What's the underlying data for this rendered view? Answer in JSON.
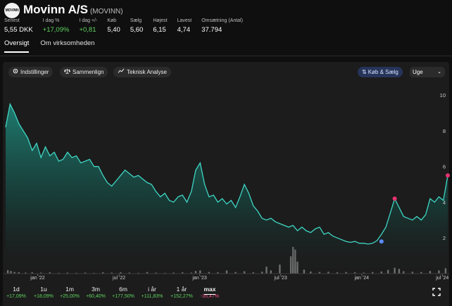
{
  "header": {
    "logo_text": "MOVINN",
    "title": "Movinn A/S",
    "ticker": "(MOVINN)"
  },
  "stats": [
    {
      "label": "Senest",
      "value": "5,55 DKK",
      "tone": "neutral"
    },
    {
      "label": "I dag %",
      "value": "+17,09%",
      "tone": "pos"
    },
    {
      "label": "I dag +/-",
      "value": "+0,81",
      "tone": "pos"
    },
    {
      "label": "Køb",
      "value": "5,40",
      "tone": "neutral"
    },
    {
      "label": "Sælg",
      "value": "5,60",
      "tone": "neutral"
    },
    {
      "label": "Højest",
      "value": "6,15",
      "tone": "neutral"
    },
    {
      "label": "Lavest",
      "value": "4,74",
      "tone": "neutral"
    },
    {
      "label": "Omsætning (Antal)",
      "value": "37.794",
      "tone": "neutral"
    }
  ],
  "tabs": [
    {
      "label": "Oversigt",
      "active": true
    },
    {
      "label": "Om virksomheden",
      "active": false
    }
  ],
  "toolbar": {
    "settings": "Indstillinger",
    "compare": "Sammenlign",
    "technical": "Teknisk Analyse",
    "trade": "Køb & Sælg",
    "period": "Uge"
  },
  "ranges": [
    {
      "label": "1d",
      "change": "+17,09%",
      "tone": "pos",
      "active": false
    },
    {
      "label": "1u",
      "change": "+18,09%",
      "tone": "pos",
      "active": false
    },
    {
      "label": "1m",
      "change": "+25,00%",
      "tone": "pos",
      "active": false
    },
    {
      "label": "3m",
      "change": "+60,40%",
      "tone": "pos",
      "active": false
    },
    {
      "label": "6m",
      "change": "+177,50%",
      "tone": "pos",
      "active": false
    },
    {
      "label": "i år",
      "change": "+111,83%",
      "tone": "pos",
      "active": false
    },
    {
      "label": "1 år",
      "change": "+152,27%",
      "tone": "pos",
      "active": false
    },
    {
      "label": "max",
      "change": "-35,47%",
      "tone": "neg",
      "active": true
    }
  ],
  "colors": {
    "line": "#3fd6c4",
    "positive": "#5fd35f",
    "negative": "#ff4f8b",
    "high_marker": "#e8336f",
    "low_marker": "#5b8dff"
  },
  "chart_data": {
    "type": "area",
    "x_axis_ticks": [
      "jan '22",
      "jul '22",
      "jan '23",
      "jul '23",
      "jan '24",
      "jul '24"
    ],
    "y_axis_ticks": [
      2,
      4,
      6,
      8,
      10
    ],
    "ylim": [
      1.1,
      10.6
    ],
    "xlim": [
      0,
      100
    ],
    "tick_positions": [
      9.5,
      33.6,
      57.5,
      81.5,
      105.5,
      129.4
    ],
    "grid": false,
    "price": [
      [
        0.0,
        8.2
      ],
      [
        1.0,
        9.5
      ],
      [
        2.0,
        9.0
      ],
      [
        3.0,
        8.4
      ],
      [
        4.0,
        8.0
      ],
      [
        5.0,
        7.6
      ],
      [
        6.0,
        6.9
      ],
      [
        7.0,
        7.3
      ],
      [
        8.0,
        6.5
      ],
      [
        9.0,
        7.1
      ],
      [
        10.0,
        6.6
      ],
      [
        11.0,
        6.8
      ],
      [
        12.0,
        6.3
      ],
      [
        13.0,
        6.4
      ],
      [
        14.0,
        6.8
      ],
      [
        15.0,
        6.5
      ],
      [
        16.0,
        6.6
      ],
      [
        17.0,
        6.2
      ],
      [
        18.0,
        6.3
      ],
      [
        19.0,
        6.4
      ],
      [
        20.0,
        6.0
      ],
      [
        21.0,
        6.0
      ],
      [
        22.0,
        5.5
      ],
      [
        23.0,
        5.1
      ],
      [
        24.0,
        4.9
      ],
      [
        25.0,
        5.2
      ],
      [
        26.0,
        5.5
      ],
      [
        27.0,
        5.8
      ],
      [
        28.0,
        5.6
      ],
      [
        29.0,
        5.4
      ],
      [
        30.0,
        5.5
      ],
      [
        31.0,
        5.3
      ],
      [
        32.0,
        5.1
      ],
      [
        33.0,
        5.0
      ],
      [
        34.0,
        4.6
      ],
      [
        35.0,
        4.3
      ],
      [
        36.0,
        4.5
      ],
      [
        37.0,
        4.1
      ],
      [
        38.0,
        4.0
      ],
      [
        39.0,
        4.3
      ],
      [
        40.0,
        4.4
      ],
      [
        41.0,
        4.0
      ],
      [
        42.0,
        4.6
      ],
      [
        43.0,
        5.8
      ],
      [
        44.0,
        6.2
      ],
      [
        45.0,
        5.0
      ],
      [
        46.0,
        4.3
      ],
      [
        47.0,
        4.4
      ],
      [
        48.0,
        4.0
      ],
      [
        49.0,
        4.2
      ],
      [
        50.0,
        3.9
      ],
      [
        51.0,
        4.1
      ],
      [
        52.0,
        3.7
      ],
      [
        53.0,
        4.3
      ],
      [
        54.0,
        5.0
      ],
      [
        55.0,
        4.5
      ],
      [
        56.0,
        3.8
      ],
      [
        57.0,
        3.5
      ],
      [
        58.0,
        3.1
      ],
      [
        59.0,
        3.0
      ],
      [
        60.0,
        3.1
      ],
      [
        61.0,
        2.9
      ],
      [
        62.0,
        2.8
      ],
      [
        63.0,
        2.7
      ],
      [
        64.0,
        2.6
      ],
      [
        65.0,
        2.7
      ],
      [
        66.0,
        2.4
      ],
      [
        67.0,
        2.6
      ],
      [
        68.0,
        2.4
      ],
      [
        69.0,
        2.3
      ],
      [
        70.0,
        2.5
      ],
      [
        71.0,
        2.6
      ],
      [
        72.0,
        2.2
      ],
      [
        73.0,
        2.3
      ],
      [
        74.0,
        2.1
      ],
      [
        75.0,
        2.0
      ],
      [
        76.0,
        1.9
      ],
      [
        77.0,
        1.8
      ],
      [
        78.0,
        1.75
      ],
      [
        79.0,
        1.8
      ],
      [
        80.0,
        1.7
      ],
      [
        81.0,
        1.7
      ],
      [
        82.0,
        1.65
      ],
      [
        83.0,
        1.7
      ],
      [
        84.0,
        1.85
      ],
      [
        85.0,
        2.2
      ],
      [
        86.0,
        2.6
      ],
      [
        87.0,
        3.4
      ],
      [
        88.0,
        4.2
      ],
      [
        89.0,
        3.7
      ],
      [
        90.0,
        3.2
      ],
      [
        91.0,
        3.1
      ],
      [
        92.0,
        3.0
      ],
      [
        93.0,
        3.2
      ],
      [
        94.0,
        3.0
      ],
      [
        95.0,
        3.3
      ],
      [
        96.0,
        4.2
      ],
      [
        97.0,
        4.0
      ],
      [
        98.0,
        4.3
      ],
      [
        99.0,
        4.1
      ],
      [
        100.0,
        5.5
      ]
    ],
    "volume": [
      [
        0.5,
        0.13
      ],
      [
        1.2,
        0.1
      ],
      [
        2.0,
        0.06
      ],
      [
        3.0,
        0.05
      ],
      [
        4.5,
        0.04
      ],
      [
        6.0,
        0.05
      ],
      [
        8.0,
        0.04
      ],
      [
        10.0,
        0.05
      ],
      [
        12.0,
        0.03
      ],
      [
        14.0,
        0.04
      ],
      [
        16.0,
        0.03
      ],
      [
        18.0,
        0.04
      ],
      [
        20.0,
        0.03
      ],
      [
        22.0,
        0.05
      ],
      [
        24.0,
        0.04
      ],
      [
        26.0,
        0.05
      ],
      [
        28.0,
        0.04
      ],
      [
        30.0,
        0.03
      ],
      [
        32.0,
        0.06
      ],
      [
        34.0,
        0.04
      ],
      [
        36.0,
        0.03
      ],
      [
        38.0,
        0.04
      ],
      [
        40.0,
        0.05
      ],
      [
        42.0,
        0.04
      ],
      [
        43.0,
        0.1
      ],
      [
        44.0,
        0.12
      ],
      [
        46.0,
        0.06
      ],
      [
        48.0,
        0.05
      ],
      [
        50.0,
        0.12
      ],
      [
        52.0,
        0.06
      ],
      [
        54.0,
        0.09
      ],
      [
        56.0,
        0.05
      ],
      [
        58.0,
        0.07
      ],
      [
        59.0,
        0.26
      ],
      [
        60.0,
        0.12
      ],
      [
        62.0,
        0.34
      ],
      [
        64.5,
        0.65
      ],
      [
        65.0,
        1.0
      ],
      [
        65.5,
        0.9
      ],
      [
        66.0,
        0.45
      ],
      [
        67.5,
        0.15
      ],
      [
        69.0,
        0.08
      ],
      [
        71.0,
        0.06
      ],
      [
        73.0,
        0.07
      ],
      [
        75.0,
        0.05
      ],
      [
        77.0,
        0.06
      ],
      [
        79.0,
        0.05
      ],
      [
        81.0,
        0.04
      ],
      [
        83.0,
        0.06
      ],
      [
        85.0,
        0.08
      ],
      [
        86.5,
        0.14
      ],
      [
        88.0,
        0.22
      ],
      [
        89.0,
        0.18
      ],
      [
        90.0,
        0.09
      ],
      [
        92.0,
        0.07
      ],
      [
        94.0,
        0.06
      ],
      [
        96.0,
        0.1
      ],
      [
        98.0,
        0.12
      ],
      [
        99.5,
        0.2
      ]
    ],
    "markers": [
      {
        "x": 88.0,
        "y": 4.2,
        "kind": "high"
      },
      {
        "x": 85.0,
        "y": 1.8,
        "kind": "low"
      },
      {
        "x": 100.0,
        "y": 5.5,
        "kind": "last"
      }
    ]
  }
}
